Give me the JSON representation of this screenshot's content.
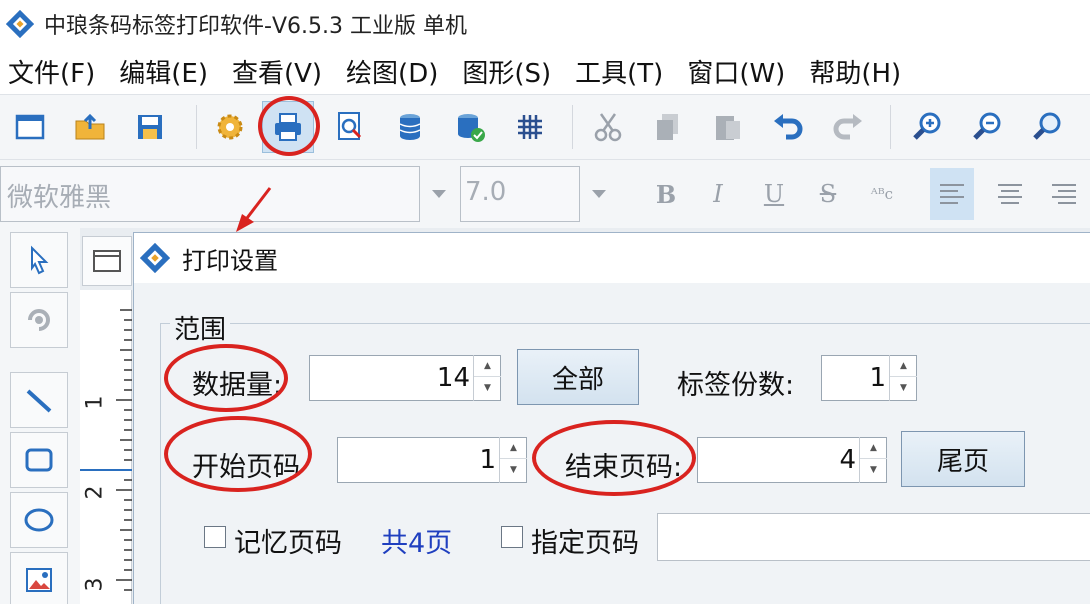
{
  "window": {
    "title": "中琅条码标签打印软件-V6.5.3 工业版 单机",
    "app_icon": "app-logo-icon"
  },
  "menu": {
    "items": [
      "文件(F)",
      "编辑(E)",
      "查看(V)",
      "绘图(D)",
      "图形(S)",
      "工具(T)",
      "窗口(W)",
      "帮助(H)"
    ]
  },
  "toolbar": {
    "buttons": [
      "new-document-icon",
      "open-folder-icon",
      "save-icon",
      "settings-gear-icon",
      "print-icon",
      "print-preview-icon",
      "database-icon",
      "database-connect-icon",
      "grid-icon",
      "cut-icon",
      "copy-icon",
      "paste-icon",
      "undo-icon",
      "redo-icon",
      "zoom-in-icon",
      "zoom-out-icon",
      "zoom-fit-icon"
    ],
    "active": "print-icon"
  },
  "fontbar": {
    "font_name": "微软雅黑",
    "font_size": "7.0",
    "format_buttons": [
      "B",
      "I",
      "U",
      "S",
      "ᴬᴮc"
    ]
  },
  "tools": {
    "items": [
      "select-arrow-icon",
      "rotate-icon",
      "line-icon",
      "rectangle-icon",
      "ellipse-icon",
      "image-icon"
    ]
  },
  "ruler": {
    "labels": [
      "1",
      "2",
      "3"
    ]
  },
  "dialog": {
    "title": "打印设置",
    "range_group_label": "范围",
    "data_count_label": "数据量:",
    "data_count_value": "14",
    "all_button": "全部",
    "copies_label": "标签份数:",
    "copies_value": "1",
    "start_page_label": "开始页码",
    "start_page_value": "1",
    "end_page_label": "结束页码:",
    "end_page_value": "4",
    "last_page_button": "尾页",
    "remember_page_label": "记忆页码",
    "total_pages_text": "共4页",
    "specify_page_label": "指定页码",
    "specify_page_value": ""
  },
  "colors": {
    "annotation_red": "#d9231f",
    "toolbar_bg": "#f4f6f8",
    "active_bg": "#cfe2f3",
    "total_pages_blue": "#1f3fbf"
  }
}
